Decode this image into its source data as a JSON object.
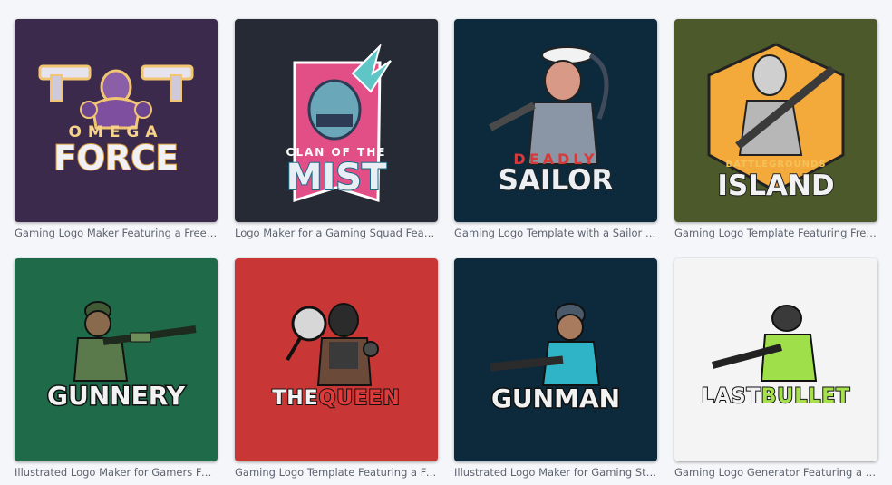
{
  "cards": [
    {
      "bg": "#3c2a4d",
      "logo_top": "OMEGA",
      "logo_main": "FORCE",
      "caption": "Gaming Logo Maker Featuring a Free Fire…"
    },
    {
      "bg": "#262a35",
      "logo_top": "CLAN OF THE",
      "logo_main": "MIST",
      "caption": "Logo Maker for a Gaming Squad Featurin…"
    },
    {
      "bg": "#0d2a3d",
      "logo_top": "DEADLY",
      "logo_main": "SAILOR",
      "caption": "Gaming Logo Template with a Sailor Wo…"
    },
    {
      "bg": "#4c592b",
      "logo_top": "BATTLEGROUNDS",
      "logo_main": "ISLAND",
      "caption": "Gaming Logo Template Featuring Free Fir…"
    },
    {
      "bg": "#1f6b49",
      "logo_main": "GUNNERY",
      "caption": "Illustrated Logo Maker for Gamers Featur…"
    },
    {
      "bg": "#c93636",
      "logo_main_a": "THE",
      "logo_main_b": "QUEEN",
      "caption": "Gaming Logo Template Featuring a Fema…"
    },
    {
      "bg": "#0d2a3d",
      "logo_main": "GUNMAN",
      "caption": "Illustrated Logo Maker for Gaming Strea…"
    },
    {
      "bg": "#f4f4f4",
      "logo_main_a": "LAST",
      "logo_main_b": "BULLET",
      "caption": "Gaming Logo Generator Featuring a Spec…"
    }
  ]
}
